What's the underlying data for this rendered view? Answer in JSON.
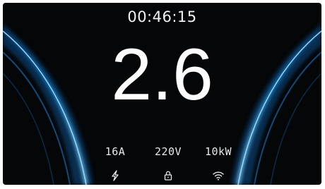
{
  "display": {
    "timer": "00:46:15",
    "value": "2.6"
  },
  "stats": [
    {
      "label": "16A"
    },
    {
      "label": "220V"
    },
    {
      "label": "10kW"
    }
  ],
  "status_icons": [
    {
      "icon": "lightning-icon"
    },
    {
      "icon": "lock-icon"
    },
    {
      "icon": "wifi-icon"
    }
  ],
  "colors": {
    "background": "#050608",
    "accent": "#1e9be0",
    "text": "#ffffff"
  }
}
